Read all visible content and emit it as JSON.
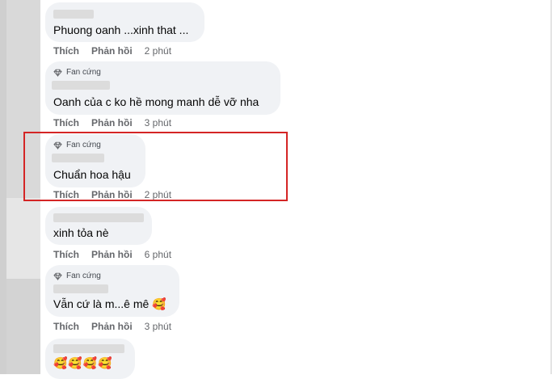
{
  "fan_badge_label": "Fan cứng",
  "action_like": "Thích",
  "action_reply": "Phản hồi",
  "comments": [
    {
      "text": "Phuong oanh ...xinh that ...",
      "time": "2 phút",
      "fan": false
    },
    {
      "text": "Oanh của c ko hề mong manh dễ vỡ nha",
      "time": "3 phút",
      "fan": true
    },
    {
      "text": "Chuẩn hoa hậu",
      "time": "2 phút",
      "fan": true,
      "highlighted": true
    },
    {
      "text": "xinh tỏa nè",
      "time": "6 phút",
      "fan": false
    },
    {
      "text": "Vẫn cứ là m...ê mê",
      "emoji": "🥰",
      "time": "3 phút",
      "fan": true
    },
    {
      "text": "",
      "emoji": "🥰🥰🥰🥰",
      "fan": false
    }
  ],
  "colors": {
    "bubble": "#f0f2f5",
    "highlight": "#d42525",
    "meta": "#65676b"
  },
  "icons": {
    "fan_badge": "diamond-icon",
    "emoji": "smiling-face-with-hearts"
  }
}
